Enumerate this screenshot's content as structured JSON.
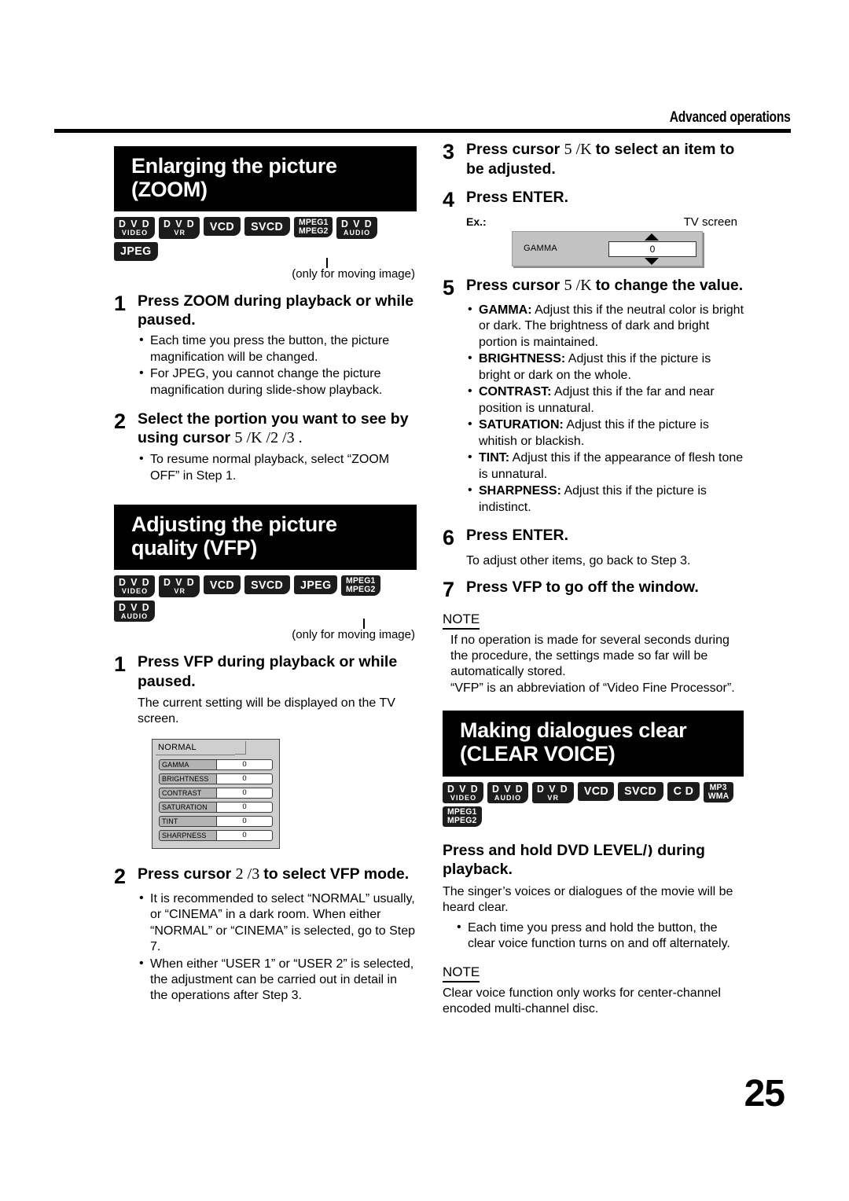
{
  "header": {
    "section_label": "Advanced operations"
  },
  "page_number": "25",
  "left_column": {
    "zoom_section": {
      "title_line1": "Enlarging the picture",
      "title_line2": "(ZOOM)",
      "badges": [
        {
          "t1": "D V D",
          "t2": "VIDEO"
        },
        {
          "t1": "D V D",
          "t2": "VR"
        },
        {
          "t1": "VCD",
          "t2": ""
        },
        {
          "t1": "SVCD",
          "t2": ""
        },
        {
          "t1": "MPEG1",
          "t2": "MPEG2"
        },
        {
          "t1": "D V D",
          "t2": "AUDIO"
        },
        {
          "t1": "JPEG",
          "t2": ""
        }
      ],
      "badge_note": "(only for moving image)",
      "steps": [
        {
          "num": "1",
          "text": "Press ZOOM during playback or while paused.",
          "bullets": [
            "Each time you press the button, the picture magnification will be changed.",
            "For JPEG, you cannot change the picture magnification during slide-show playback."
          ]
        },
        {
          "num": "2",
          "text_a": "Select the portion you want to see by using cursor ",
          "cursor": "5  /K  /2  /3  .",
          "bullets": [
            "To resume normal playback, select “ZOOM OFF” in Step 1."
          ]
        }
      ]
    },
    "vfp_section": {
      "title_line1": "Adjusting the picture",
      "title_line2": "quality (VFP)",
      "badges": [
        {
          "t1": "D V D",
          "t2": "VIDEO"
        },
        {
          "t1": "D V D",
          "t2": "VR"
        },
        {
          "t1": "VCD",
          "t2": ""
        },
        {
          "t1": "SVCD",
          "t2": ""
        },
        {
          "t1": "JPEG",
          "t2": ""
        },
        {
          "t1": "MPEG1",
          "t2": "MPEG2"
        },
        {
          "t1": "D V D",
          "t2": "AUDIO"
        }
      ],
      "badge_note": "(only for moving image)",
      "step1": {
        "num": "1",
        "text": "Press VFP during playback or while paused.",
        "body": "The current setting will be displayed on the TV screen."
      },
      "panel": {
        "tab_label": "NORMAL",
        "rows": [
          {
            "name": "GAMMA",
            "value": "0"
          },
          {
            "name": "BRIGHTNESS",
            "value": "0"
          },
          {
            "name": "CONTRAST",
            "value": "0"
          },
          {
            "name": "SATURATION",
            "value": "0"
          },
          {
            "name": "TINT",
            "value": "0"
          },
          {
            "name": "SHARPNESS",
            "value": "0"
          }
        ]
      },
      "step2": {
        "num": "2",
        "text_a": "Press cursor ",
        "cursor": "2  /3 ",
        "text_b": " to select VFP mode.",
        "bullets": [
          "It is recommended to select “NORMAL” usually, or “CINEMA” in a dark room. When either “NORMAL” or “CINEMA” is selected, go to Step 7.",
          "When either “USER 1” or “USER 2” is selected, the adjustment can be carried out in detail in the operations after Step 3."
        ]
      }
    }
  },
  "right_column": {
    "step3": {
      "num": "3",
      "text_a": "Press cursor ",
      "cursor": "5  /K ",
      "text_b": " to select an item to be adjusted."
    },
    "step4": {
      "num": "4",
      "text": "Press ENTER.",
      "ex_label": "Ex.:",
      "tv_label": "TV screen",
      "gamma_name": "GAMMA",
      "gamma_value": "0"
    },
    "step5": {
      "num": "5",
      "text_a": "Press cursor ",
      "cursor": "5  /K ",
      "text_b": " to change the value.",
      "bullets": [
        {
          "term": "GAMMA:",
          "desc": " Adjust this if the neutral color is bright or dark. The brightness of dark and bright portion is maintained."
        },
        {
          "term": "BRIGHTNESS:",
          "desc": " Adjust this if the picture is bright or dark on the whole."
        },
        {
          "term": "CONTRAST:",
          "desc": " Adjust this if the far and near position is unnatural."
        },
        {
          "term": "SATURATION:",
          "desc": " Adjust this if the picture is whitish or blackish."
        },
        {
          "term": "TINT:",
          "desc": " Adjust this if the appearance of flesh tone is unnatural."
        },
        {
          "term": "SHARPNESS:",
          "desc": " Adjust this if the picture is indistinct."
        }
      ]
    },
    "step6": {
      "num": "6",
      "text": "Press ENTER.",
      "body": "To adjust other items, go back to Step 3."
    },
    "step7": {
      "num": "7",
      "text": "Press VFP to go off the window."
    },
    "note1": {
      "label": "NOTE",
      "line1": "If no operation is made for several seconds during the procedure, the settings made so far will be automatically stored.",
      "line2": "“VFP” is an abbreviation of “Video Fine Processor”."
    },
    "clear_voice_section": {
      "title_line1": "Making dialogues clear",
      "title_line2": "(CLEAR VOICE)",
      "badges": [
        {
          "t1": "D V D",
          "t2": "VIDEO"
        },
        {
          "t1": "D V D",
          "t2": "AUDIO"
        },
        {
          "t1": "D V D",
          "t2": "VR"
        },
        {
          "t1": "VCD",
          "t2": ""
        },
        {
          "t1": "SVCD",
          "t2": ""
        },
        {
          "t1": "C D",
          "t2": ""
        },
        {
          "t1": "MP3",
          "t2": "WMA"
        },
        {
          "t1": "MPEG1",
          "t2": "MPEG2"
        }
      ],
      "heading_a": "Press and hold DVD LEVEL/",
      "heading_glyph": "\u0001)",
      "heading_b": " during playback.",
      "body": "The singer’s voices or dialogues of the movie will be heard clear.",
      "bullets": [
        "Each time you press and hold the button, the clear voice function turns on and off alternately."
      ],
      "note": {
        "label": "NOTE",
        "body": "Clear voice function only works for center-channel encoded multi-channel disc."
      }
    }
  }
}
